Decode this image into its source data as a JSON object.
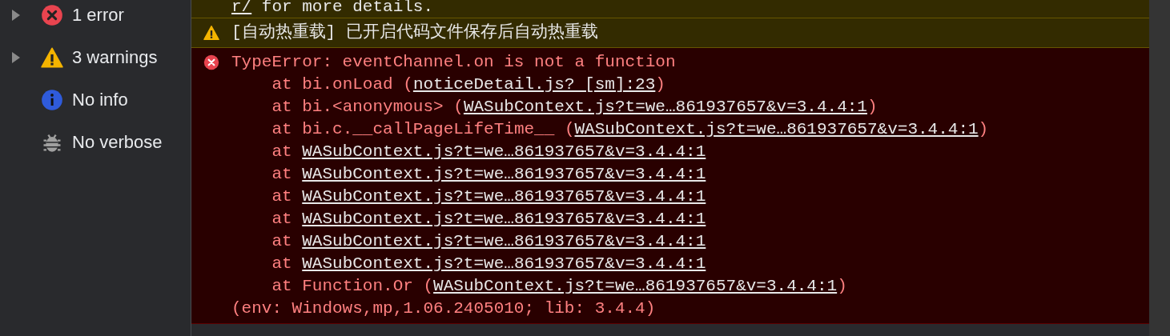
{
  "sidebar": {
    "items": [
      {
        "label": "1 error",
        "kind": "error",
        "expandable": true
      },
      {
        "label": "3 warnings",
        "kind": "warning",
        "expandable": true
      },
      {
        "label": "No info",
        "kind": "info",
        "expandable": false
      },
      {
        "label": "No verbose",
        "kind": "verbose",
        "expandable": false
      }
    ]
  },
  "console": {
    "messages": [
      {
        "kind": "continuation",
        "link": "r/",
        "text": "for more details."
      },
      {
        "kind": "warning",
        "text": "[自动热重载] 已开启代码文件保存后自动热重载"
      },
      {
        "kind": "error",
        "text": "TypeError: eventChannel.on is not a function",
        "frames": [
          {
            "prefix": "at",
            "function": "bi.onLoad",
            "open": "(",
            "location": "noticeDetail.js? [sm]:23",
            "close": ")"
          },
          {
            "prefix": "at",
            "function": "bi.<anonymous>",
            "open": "(",
            "location": "WASubContext.js?t=we…861937657&v=3.4.4:1",
            "close": ")"
          },
          {
            "prefix": "at",
            "function": "bi.c.__callPageLifeTime__",
            "open": "(",
            "location": "WASubContext.js?t=we…861937657&v=3.4.4:1",
            "close": ")"
          },
          {
            "prefix": "at",
            "location": "WASubContext.js?t=we…861937657&v=3.4.4:1"
          },
          {
            "prefix": "at",
            "location": "WASubContext.js?t=we…861937657&v=3.4.4:1"
          },
          {
            "prefix": "at",
            "location": "WASubContext.js?t=we…861937657&v=3.4.4:1"
          },
          {
            "prefix": "at",
            "location": "WASubContext.js?t=we…861937657&v=3.4.4:1"
          },
          {
            "prefix": "at",
            "location": "WASubContext.js?t=we…861937657&v=3.4.4:1"
          },
          {
            "prefix": "at",
            "location": "WASubContext.js?t=we…861937657&v=3.4.4:1"
          },
          {
            "prefix": "at",
            "function": "Function.Or",
            "open": "(",
            "location": "WASubContext.js?t=we…861937657&v=3.4.4:1",
            "close": ")"
          }
        ],
        "footer": "(env: Windows,mp,1.06.2405010; lib: 3.4.4)"
      }
    ]
  }
}
